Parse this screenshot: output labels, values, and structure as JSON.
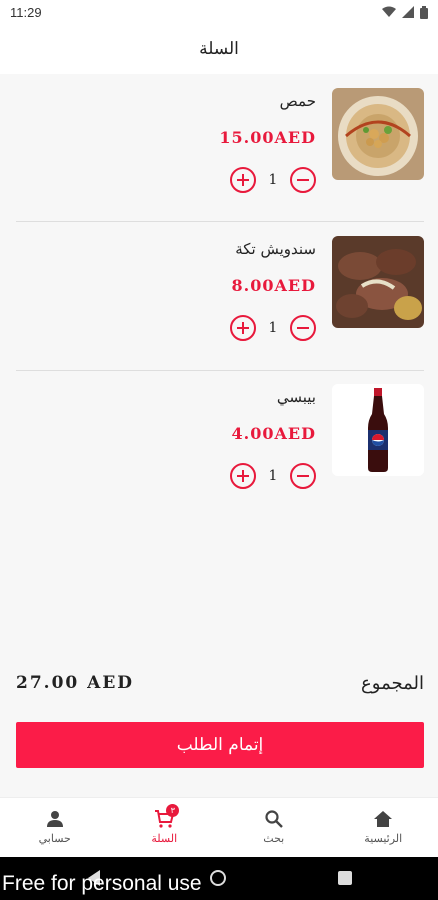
{
  "status_bar": {
    "time": "11:29"
  },
  "header": {
    "title": "السلة"
  },
  "cart": {
    "items": [
      {
        "name": "حمص",
        "price": "15.00AED",
        "quantity": "1"
      },
      {
        "name": "سندويش تكة",
        "price": "8.00AED",
        "quantity": "1"
      },
      {
        "name": "بيبسي",
        "price": "4.00AED",
        "quantity": "1"
      }
    ],
    "total_label": "المجموع",
    "total_amount": "27.00 AED",
    "checkout_label": "إتمام الطلب"
  },
  "bottom_nav": {
    "items": [
      {
        "label": "حسابي",
        "icon": "person-icon"
      },
      {
        "label": "السلة",
        "icon": "cart-icon",
        "badge": "٣"
      },
      {
        "label": "بحث",
        "icon": "search-icon"
      },
      {
        "label": "الرئيسية",
        "icon": "home-icon"
      }
    ]
  },
  "watermark": "Free for personal use",
  "colors": {
    "accent": "#e8193c",
    "checkout": "#fb1c48",
    "background": "#f7f7f7"
  }
}
